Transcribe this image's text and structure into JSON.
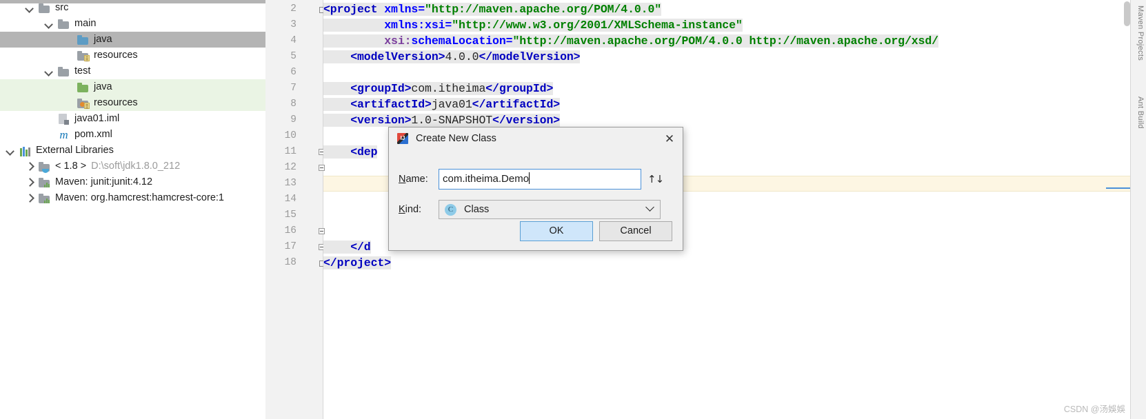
{
  "project_tree": {
    "items": [
      {
        "label": "src",
        "depth": 1,
        "arrow": "down",
        "icon": "folder-gray",
        "state": "none"
      },
      {
        "label": "main",
        "depth": 2,
        "arrow": "down",
        "icon": "folder-gray",
        "state": "none"
      },
      {
        "label": "java",
        "depth": 3,
        "arrow": "none",
        "icon": "folder-blue",
        "state": "selected"
      },
      {
        "label": "resources",
        "depth": 3,
        "arrow": "none",
        "icon": "folder-gray-resource",
        "state": "none"
      },
      {
        "label": "test",
        "depth": 2,
        "arrow": "down",
        "icon": "folder-gray",
        "state": "none"
      },
      {
        "label": "java",
        "depth": 3,
        "arrow": "none",
        "icon": "folder-green",
        "state": "highlight"
      },
      {
        "label": "resources",
        "depth": 3,
        "arrow": "none",
        "icon": "folder-test-resource",
        "state": "highlight"
      },
      {
        "label": "java01.iml",
        "depth": 2,
        "arrow": "none",
        "icon": "iml-file",
        "state": "none"
      },
      {
        "label": "pom.xml",
        "depth": 2,
        "arrow": "none",
        "icon": "maven-m",
        "state": "none"
      },
      {
        "label": "External Libraries",
        "depth": 0,
        "arrow": "down",
        "icon": "libraries",
        "state": "none"
      },
      {
        "label": "< 1.8 >",
        "depth": 1,
        "arrow": "right",
        "icon": "jdk-folder",
        "state": "none",
        "suffix": "D:\\soft\\jdk1.8.0_212"
      },
      {
        "label": "Maven: junit:junit:4.12",
        "depth": 1,
        "arrow": "right",
        "icon": "lib-folder",
        "state": "none"
      },
      {
        "label": "Maven: org.hamcrest:hamcrest-core:1",
        "depth": 1,
        "arrow": "right",
        "icon": "lib-folder",
        "state": "none"
      }
    ]
  },
  "editor": {
    "line_numbers": [
      "2",
      "3",
      "4",
      "5",
      "6",
      "7",
      "8",
      "9",
      "10",
      "11",
      "12",
      "13",
      "14",
      "15",
      "16",
      "17",
      "18"
    ],
    "lines": [
      {
        "num": "2",
        "segments": [
          {
            "t": "<project ",
            "c": "tag"
          },
          {
            "t": "xmlns=",
            "c": "attr"
          },
          {
            "t": "\"http://maven.apache.org/POM/4.0.0\"",
            "c": "str"
          }
        ]
      },
      {
        "num": "3",
        "segments": [
          {
            "t": "         xmlns:xsi=",
            "c": "attr"
          },
          {
            "t": "\"http://www.w3.org/2001/XMLSchema-instance\"",
            "c": "str"
          }
        ]
      },
      {
        "num": "4",
        "segments": [
          {
            "t": "         xsi:",
            "c": "attrns"
          },
          {
            "t": "schemaLocation=",
            "c": "attr"
          },
          {
            "t": "\"http://maven.apache.org/POM/4.0.0 http://maven.apache.org/xsd/",
            "c": "str"
          }
        ]
      },
      {
        "num": "5",
        "segments": [
          {
            "t": "    <modelVersion>",
            "c": "tag"
          },
          {
            "t": "4.0.0",
            "c": "txt"
          },
          {
            "t": "</modelVersion>",
            "c": "tag"
          }
        ]
      },
      {
        "num": "6",
        "segments": [
          {
            "t": "",
            "c": "txt"
          }
        ]
      },
      {
        "num": "7",
        "segments": [
          {
            "t": "    <groupId>",
            "c": "tag"
          },
          {
            "t": "com.itheima",
            "c": "txt"
          },
          {
            "t": "</groupId>",
            "c": "tag"
          }
        ]
      },
      {
        "num": "8",
        "segments": [
          {
            "t": "    <artifactId>",
            "c": "tag"
          },
          {
            "t": "java01",
            "c": "txt"
          },
          {
            "t": "</artifactId>",
            "c": "tag"
          }
        ]
      },
      {
        "num": "9",
        "segments": [
          {
            "t": "    <version>",
            "c": "tag"
          },
          {
            "t": "1.0-SNAPSHOT",
            "c": "txt"
          },
          {
            "t": "</version>",
            "c": "tag"
          }
        ]
      },
      {
        "num": "10",
        "segments": [
          {
            "t": "",
            "c": "txt"
          }
        ]
      },
      {
        "num": "11",
        "segments": [
          {
            "t": "    <dep",
            "c": "tag"
          }
        ]
      },
      {
        "num": "12",
        "segments": [
          {
            "t": "",
            "c": "txt"
          }
        ]
      },
      {
        "num": "13",
        "segments": [
          {
            "t": "",
            "c": "txt"
          }
        ]
      },
      {
        "num": "14",
        "segments": [
          {
            "t": "",
            "c": "txt"
          }
        ]
      },
      {
        "num": "15",
        "segments": [
          {
            "t": "",
            "c": "txt"
          }
        ]
      },
      {
        "num": "16",
        "segments": [
          {
            "t": "",
            "c": "txt"
          }
        ]
      },
      {
        "num": "17",
        "segments": [
          {
            "t": "    </d",
            "c": "tag"
          }
        ]
      },
      {
        "num": "18",
        "segments": [
          {
            "t": "</project>",
            "c": "tag"
          }
        ]
      }
    ],
    "right_tabs": [
      "Maven Projects",
      "Ant Build"
    ]
  },
  "dialog": {
    "title": "Create New Class",
    "close_label": "✕",
    "name_label_prefix": "",
    "name_label_mnemonic": "N",
    "name_label_suffix": "ame:",
    "name_value": "com.itheima.Demo",
    "name_placeholder": "",
    "updown_label": "↑↓",
    "kind_label_mnemonic": "K",
    "kind_label_suffix": "ind:",
    "kind_value": "Class",
    "kind_icon_letter": "C",
    "ok_label": "OK",
    "cancel_label": "Cancel"
  },
  "watermark": {
    "text": "CSDN @汤娛娛"
  },
  "colors": {
    "selection_gray": "#b4b4b4",
    "selection_green": "#eaf4e4",
    "caret_line": "#fdf6e3",
    "accent_blue": "#4a90d9",
    "xml_tag": "#0000c0",
    "xml_attr": "#0000ff",
    "xml_string": "#008000"
  }
}
